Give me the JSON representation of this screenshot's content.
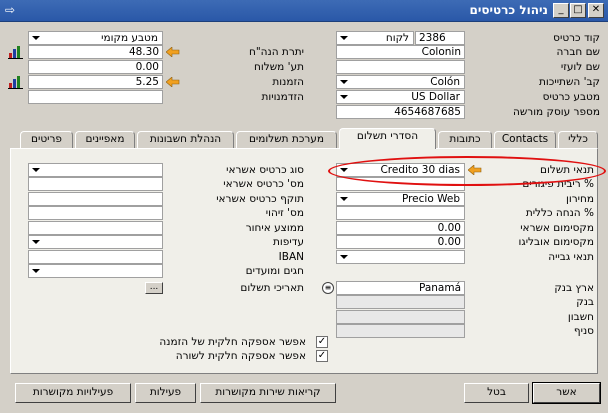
{
  "window": {
    "title": "ניהול כרטיסים",
    "minimize": "_",
    "restore": "□",
    "close": "✕"
  },
  "header_right": {
    "code_label": "קוד כרטיס",
    "code_value": "2386",
    "type_value": "לקוח",
    "company_label": "שם חברה",
    "company_value": "Colonin",
    "foreign_label": "שם לועזי",
    "foreign_value": "",
    "group_label": "קב' השתייכות",
    "group_value": "Colón",
    "currency_label": "מטבע כרטיס",
    "currency_value": "US Dollar",
    "tax_label": "מספר עוסק מורשה",
    "tax_value": "4654687685"
  },
  "header_left": {
    "curr_select": "מטבע מקומי",
    "balance_label": "יתרת הנה\"ח",
    "balance_value": "48.30",
    "deliveries_label": "תע' משלוח",
    "deliveries_value": "0.00",
    "orders_label": "הזמנות",
    "orders_value": "5.25",
    "opportunities_label": "הזדמנויות",
    "opportunities_value": ""
  },
  "tabs": [
    "כללי",
    "Contacts",
    "כתובות",
    "הסדרי תשלום",
    "מערכת תשלומים",
    "הנהלת חשבונות",
    "מאפיינים",
    "פריטים"
  ],
  "payment_right": {
    "terms_label": "תנאי תשלום",
    "terms_value": "Credito 30 dias",
    "interest_label": "% ריבית פיגורים",
    "interest_value": "",
    "pricelist_label": "מחירון",
    "pricelist_value": "Precio Web",
    "discount_label": "% הנחה כללית",
    "discount_value": "",
    "credit_label": "מקסימום אשראי",
    "credit_value": "0.00",
    "commit_label": "מקסימום אובליגו",
    "commit_value": "0.00",
    "collection_label": "תנאי גבייה",
    "collection_value": "",
    "bank_country_label": "ארץ בנק",
    "bank_country_value": "Panamá",
    "bank_label": "בנק",
    "account_label": "חשבון",
    "branch_label": "סניף"
  },
  "payment_left": {
    "card_type_label": "סוג כרטיס אשראי",
    "card_no_label": "מס' כרטיס אשראי",
    "card_exp_label": "תוקף כרטיס אשראי",
    "id_label": "מס' זיהוי",
    "avg_delay_label": "ממוצע איחור",
    "priority_label": "עדיפות",
    "iban_label": "IBAN",
    "holidays_label": "חגים ומועדים",
    "pay_dates_label": "תאריכי תשלום",
    "dots": "..."
  },
  "checkboxes": [
    {
      "label": "אפשר אספקה חלקית של הזמנה",
      "checked": true
    },
    {
      "label": "אפשר אספקה חלקית לשורה",
      "checked": true
    }
  ],
  "buttons": {
    "ok": "אשר",
    "cancel": "בטל",
    "linked_activities": "פעילויות מקושרות",
    "activities": "פעילות",
    "service_calls": "קריאות שירות מקושרות"
  },
  "colors": {
    "titlebar": "#2a58a8",
    "highlight_oval": "#e01010",
    "gold_arrow": "#f0a020"
  }
}
